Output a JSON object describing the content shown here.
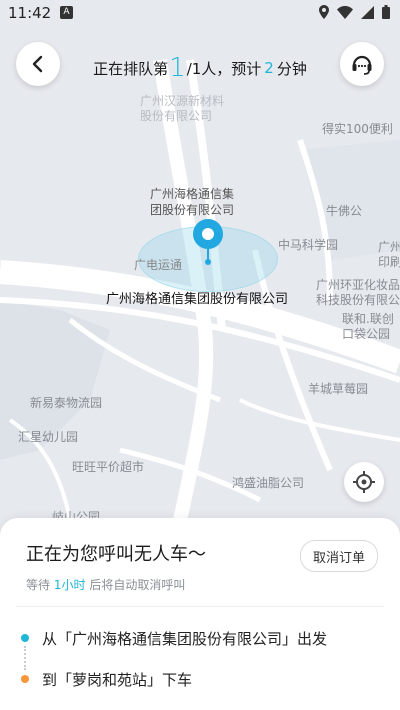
{
  "status_bar": {
    "time": "11:42",
    "notif_icon": "A"
  },
  "header": {
    "queue_prefix": "正在排队第",
    "queue_position": "1",
    "queue_total": "/1人，预计",
    "wait_minutes": "2",
    "wait_unit": "分钟"
  },
  "map": {
    "labels": [
      "广州汉源新材料\n股份有限公司",
      "得实100便利",
      "广州海格通信集\n团股份有限公司",
      "牛佛公",
      "中马科学园",
      "广州\n印刷",
      "广电运通",
      "广州海格通信集团股份有限公司",
      "广州环亚化妆品\n科技股份有限公司",
      "联和.联创\n口袋公园",
      "羊城草莓园",
      "新易泰物流园",
      "汇星幼儿园",
      "旺旺平价超市",
      "鸿盛油脂公司",
      "岐山公园"
    ]
  },
  "sheet": {
    "title": "正在为您呼叫无人车～",
    "cancel_label": "取消订单",
    "wait_prefix": "等待",
    "wait_time": "1小时",
    "wait_suffix": "后将自动取消呼叫",
    "from": "从「广州海格通信集团股份有限公司」出发",
    "to": "到「萝岗和苑站」下车"
  },
  "colors": {
    "accent": "#21b5d6",
    "dest_dot": "#f6953a"
  }
}
